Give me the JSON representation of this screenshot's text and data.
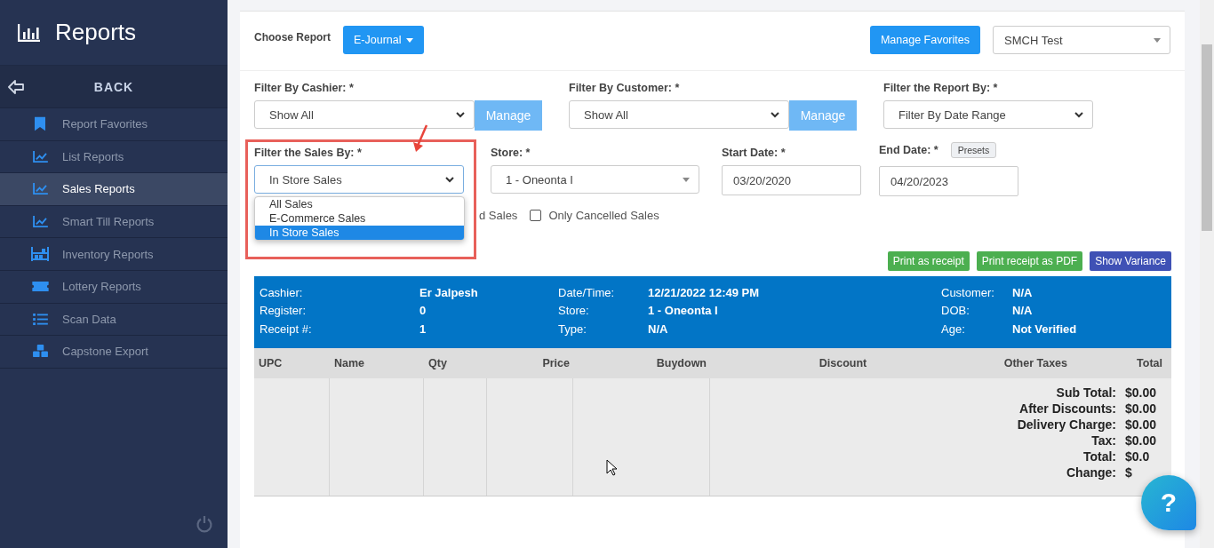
{
  "sidebar": {
    "title": "Reports",
    "back": "BACK",
    "items": [
      {
        "label": "Report Favorites",
        "selected": false
      },
      {
        "label": "List Reports",
        "selected": false
      },
      {
        "label": "Sales Reports",
        "selected": true
      },
      {
        "label": "Smart Till Reports",
        "selected": false
      },
      {
        "label": "Inventory Reports",
        "selected": false
      },
      {
        "label": "Lottery Reports",
        "selected": false
      },
      {
        "label": "Scan Data",
        "selected": false
      },
      {
        "label": "Capstone Export",
        "selected": false
      }
    ]
  },
  "toolbar": {
    "choose_label": "Choose Report",
    "report_button": "E-Journal",
    "favorites_button": "Manage Favorites",
    "profile_select": "SMCH Test"
  },
  "filters_row1": [
    {
      "label": "Filter By Cashier: *",
      "value": "Show All",
      "manage": "Manage"
    },
    {
      "label": "Filter By Customer: *",
      "value": "Show All",
      "manage": "Manage"
    },
    {
      "label": "Filter the Report By: *",
      "value": "Filter By Date Range"
    }
  ],
  "filters_row2": {
    "sales_label": "Filter the Sales By: *",
    "sales_value": "In Store Sales",
    "sales_options": [
      {
        "label": "All Sales",
        "selected": false
      },
      {
        "label": "E-Commerce Sales",
        "selected": false
      },
      {
        "label": "In Store Sales",
        "selected": true
      }
    ],
    "store_label": "Store: *",
    "store_value": "1 - Oneonta I",
    "start_label": "Start Date: *",
    "start_value": "03/20/2020",
    "end_label": "End Date: *",
    "end_value": "04/20/2023",
    "presets": "Presets"
  },
  "checkboxes": {
    "hidden_label_tail": "d Sales",
    "items": [
      {
        "label": "Only Cancelled Sales",
        "checked": false
      }
    ]
  },
  "actions": [
    "Print as receipt",
    "Print receipt as PDF",
    "Show Variance"
  ],
  "receipt": {
    "info_rows": [
      [
        {
          "label": "Cashier:",
          "value": "Er Jalpesh"
        },
        {
          "label": "Date/Time:",
          "value": "12/21/2022 12:49 PM"
        },
        {
          "label": "Customer:",
          "value": "N/A"
        }
      ],
      [
        {
          "label": "Register:",
          "value": "0"
        },
        {
          "label": "Store:",
          "value": "1 - Oneonta I"
        },
        {
          "label": "DOB:",
          "value": "N/A"
        }
      ],
      [
        {
          "label": "Receipt #:",
          "value": "1"
        },
        {
          "label": "Type:",
          "value": "N/A"
        },
        {
          "label": "Age:",
          "value": "Not Verified"
        }
      ]
    ],
    "columns": [
      "UPC",
      "Name",
      "Qty",
      "Price",
      "Buydown",
      "Discount",
      "Other Taxes",
      "Total"
    ],
    "totals": [
      {
        "label": "Sub Total:",
        "value": "$0.00"
      },
      {
        "label": "After Discounts:",
        "value": "$0.00"
      },
      {
        "label": "Delivery Charge:",
        "value": "$0.00"
      },
      {
        "label": "Tax:",
        "value": "$0.00"
      },
      {
        "label": "Total:",
        "value": "$0.0"
      },
      {
        "label": "Change:",
        "value": "$"
      }
    ]
  },
  "help_button": "?"
}
